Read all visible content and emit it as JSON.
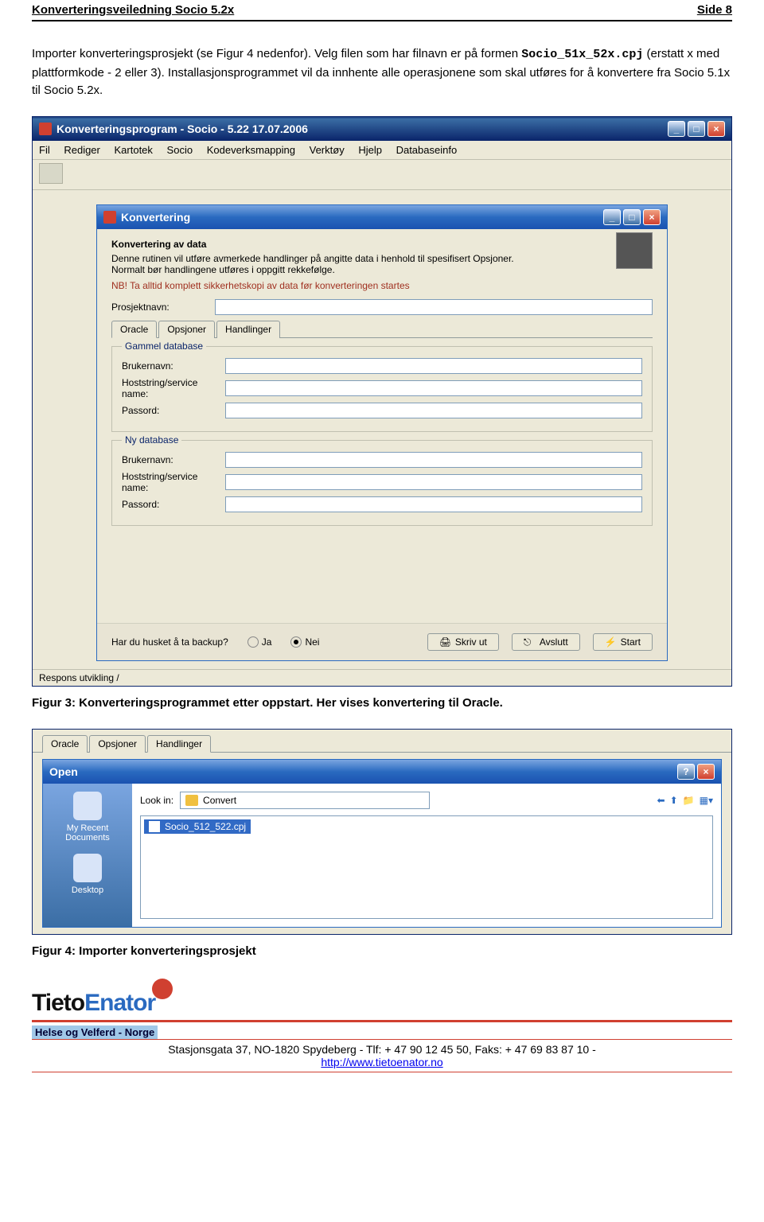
{
  "doc": {
    "header_left": "Konverteringsveiledning Socio 5.2x",
    "header_right": "Side 8"
  },
  "para": {
    "l1": "Importer konverteringsprosjekt (se Figur 4 nedenfor). Velg filen som har filnavn er på formen ",
    "code": "Socio_51x_52x.cpj",
    "l2": " (erstatt x med plattformkode - 2 eller 3). Installasjonsprogrammet vil da innhente alle operasjonene som skal utføres for å konvertere fra Socio 5.1x til Socio 5.2x."
  },
  "app": {
    "title": "Konverteringsprogram - Socio - 5.22 17.07.2006",
    "menus": [
      "Fil",
      "Rediger",
      "Kartotek",
      "Socio",
      "Kodeverksmapping",
      "Verktøy",
      "Hjelp",
      "Databaseinfo"
    ]
  },
  "konv": {
    "title": "Konvertering",
    "section": "Konvertering av data",
    "desc1": "Denne rutinen vil utføre avmerkede handlinger på angitte data i henhold til spesifisert Opsjoner.",
    "desc2": "Normalt bør handlingene utføres i oppgitt rekkefølge.",
    "warn": "NB! Ta alltid komplett sikkerhetskopi av data før konverteringen startes",
    "proj_label": "Prosjektnavn:",
    "tabs": [
      "Oracle",
      "Opsjoner",
      "Handlinger"
    ],
    "old": "Gammel database",
    "new": "Ny database",
    "f_user": "Brukernavn:",
    "f_host": "Hoststring/service name:",
    "f_pass": "Passord:",
    "backup_q": "Har du husket å ta backup?",
    "ja": "Ja",
    "nei": "Nei",
    "print": "Skriv ut",
    "exit": "Avslutt",
    "start": "Start",
    "status": "Respons utvikling /"
  },
  "fig3": "Figur 3: Konverteringsprogrammet etter oppstart. Her vises konvertering til Oracle.",
  "open": {
    "title": "Open",
    "lookin": "Look in:",
    "folder": "Convert",
    "recent": "My Recent Documents",
    "desktop": "Desktop",
    "file": "Socio_512_522.cpj"
  },
  "fig4": "Figur 4: Importer konverteringsprosjekt",
  "footer": {
    "brand1": "Tieto",
    "brand2": "Enator",
    "sub": "Helse og Velferd - Norge",
    "addr": "Stasjonsgata 37, NO-1820 Spydeberg - Tlf: + 47 90 12 45 50, Faks: + 47 69 83 87 10 -",
    "url": "http://www.tietoenator.no"
  }
}
